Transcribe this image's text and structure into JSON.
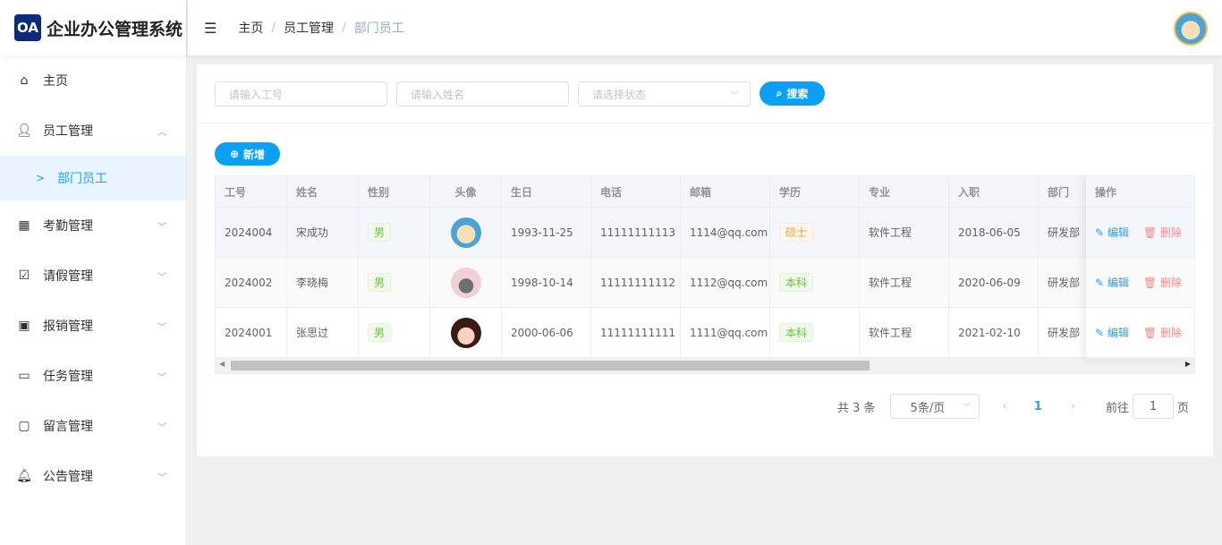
{
  "app": {
    "logo": "OA",
    "title": "企业办公管理系统"
  },
  "breadcrumb": [
    "主页",
    "员工管理",
    "部门员工"
  ],
  "sidebar": {
    "items": [
      {
        "label": "主页",
        "icon": "home-icon"
      },
      {
        "label": "员工管理",
        "icon": "user-icon",
        "expanded": true,
        "children": [
          {
            "label": "部门员工"
          }
        ]
      },
      {
        "label": "考勤管理",
        "icon": "calendar-icon"
      },
      {
        "label": "请假管理",
        "icon": "document-check-icon"
      },
      {
        "label": "报销管理",
        "icon": "wallet-icon"
      },
      {
        "label": "任务管理",
        "icon": "card-icon"
      },
      {
        "label": "留言管理",
        "icon": "chat-icon"
      },
      {
        "label": "公告管理",
        "icon": "bell-icon"
      }
    ]
  },
  "search": {
    "id_placeholder": "请输入工号",
    "name_placeholder": "请输入姓名",
    "status_placeholder": "请选择状态",
    "search_label": "搜索"
  },
  "add_label": "新增",
  "table": {
    "headers": [
      "工号",
      "姓名",
      "性别",
      "头像",
      "生日",
      "电话",
      "邮箱",
      "学历",
      "专业",
      "入职",
      "部门"
    ],
    "op_header": "操作",
    "rows": [
      {
        "id": "2024004",
        "name": "宋成功",
        "gender": "男",
        "birthday": "1993-11-25",
        "phone": "11111111113",
        "email": "1114@qq.com",
        "edu": "硕士",
        "major": "软件工程",
        "join": "2018-06-05",
        "dept": "研发部"
      },
      {
        "id": "2024002",
        "name": "李晓梅",
        "gender": "男",
        "birthday": "1998-10-14",
        "phone": "11111111112",
        "email": "1112@qq.com",
        "edu": "本科",
        "major": "软件工程",
        "join": "2020-06-09",
        "dept": "研发部"
      },
      {
        "id": "2024001",
        "name": "张思过",
        "gender": "男",
        "birthday": "2000-06-06",
        "phone": "11111111111",
        "email": "1111@qq.com",
        "edu": "本科",
        "major": "软件工程",
        "join": "2021-02-10",
        "dept": "研发部"
      }
    ],
    "edit_label": "编辑",
    "delete_label": "删除"
  },
  "pagination": {
    "total": "共 3 条",
    "page_size": "5条/页",
    "current": "1",
    "goto_prefix": "前往",
    "goto_value": "1",
    "goto_suffix": "页"
  },
  "colors": {
    "primary": "#0aa0f6",
    "danger": "#f78989",
    "master": "#e6a23c",
    "bachelor": "#67c23a"
  }
}
